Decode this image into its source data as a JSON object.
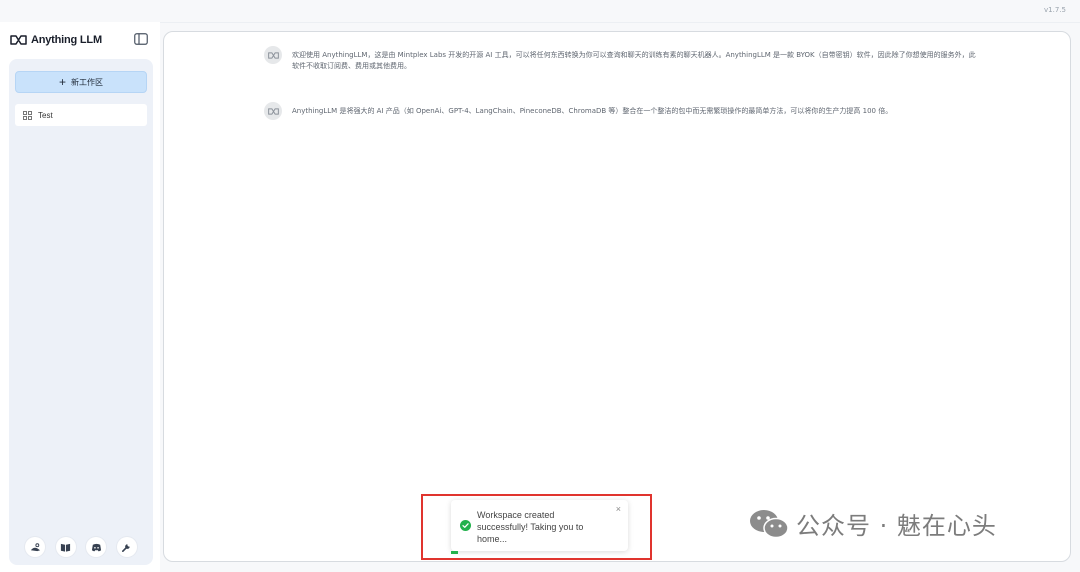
{
  "app": {
    "version": "v1.7.5",
    "brand_name": "Anything LLM"
  },
  "sidebar": {
    "new_workspace_label": "新工作区",
    "workspaces": [
      {
        "name": "Test"
      }
    ],
    "footer_icons": [
      "community-hub-icon",
      "docs-book-icon",
      "discord-icon",
      "settings-wrench-icon"
    ]
  },
  "chat": {
    "messages": [
      {
        "text": "欢迎使用 AnythingLLM，这是由 Mintplex Labs 开发的开源 AI 工具，可以将任何东西转换为你可以查询和聊天的训练有素的聊天机器人。AnythingLLM 是一款 BYOK（自带密钥）软件，因此除了你想使用的服务外，此软件不收取订阅费、费用或其他费用。"
      },
      {
        "text": "AnythingLLM 是将强大的 AI 产品（如 OpenAi、GPT-4、LangChain、PineconeDB、ChromaDB 等）整合在一个整洁的包中而无需繁琐操作的最简单方法，可以将你的生产力提高 100 倍。"
      }
    ]
  },
  "toast": {
    "message": "Workspace created successfully! Taking you to home...",
    "close_label": "×",
    "progress": 0.04,
    "status_color": "#22b14c"
  },
  "watermark": {
    "text": "公众号 · 魅在心头"
  },
  "colors": {
    "accent": "#c9e2fb",
    "highlight_border": "#e0342e"
  }
}
